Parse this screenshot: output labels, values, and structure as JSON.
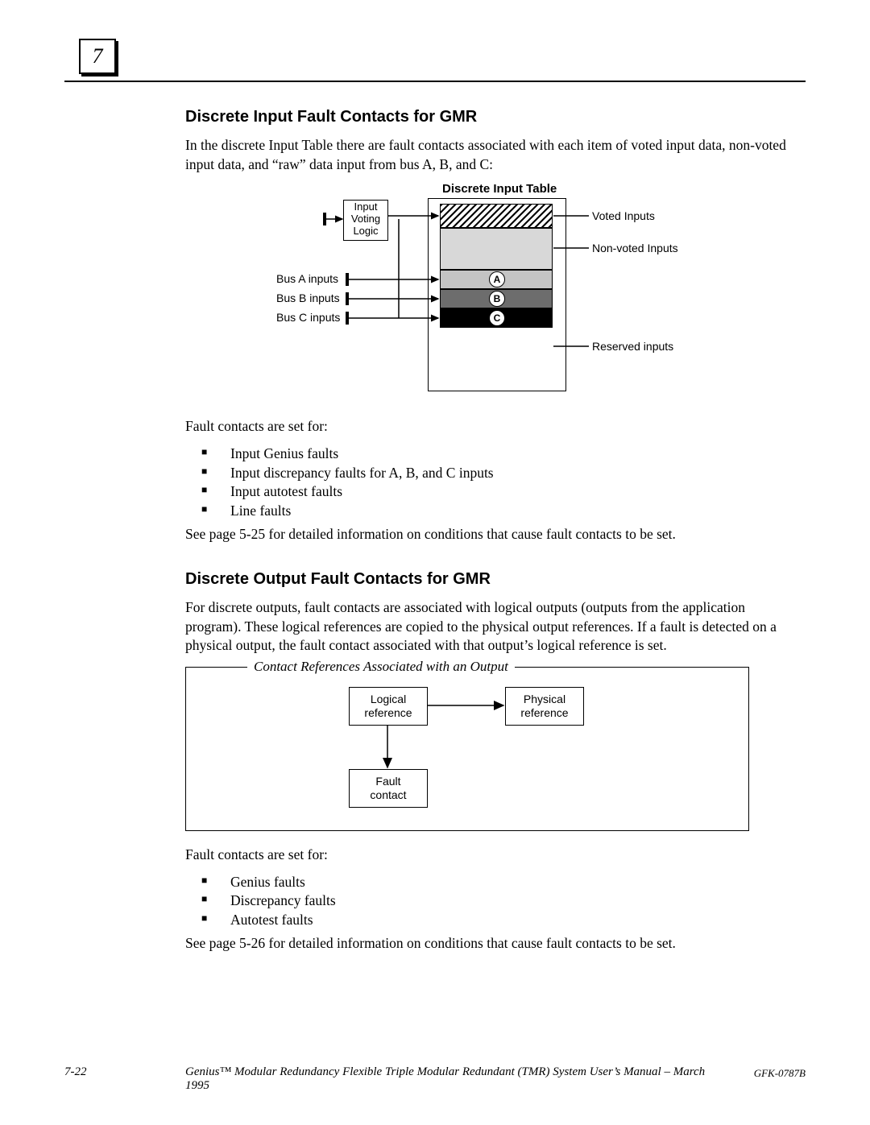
{
  "chapter_number": "7",
  "section1": {
    "title": "Discrete Input Fault Contacts for GMR",
    "intro": "In the discrete Input Table there are fault contacts associated with each item of voted input data, non-voted input data, and “raw” data input from bus A, B, and C:",
    "fig_title": "Discrete Input Table",
    "ivl_box": "Input\nVoting\nLogic",
    "labels": {
      "voted": "Voted Inputs",
      "nonvoted": "Non-voted Inputs",
      "reserved": "Reserved inputs",
      "busA": "Bus A inputs",
      "busB": "Bus B inputs",
      "busC": "Bus C inputs"
    },
    "badges": {
      "a": "A",
      "b": "B",
      "c": "C"
    },
    "fault_heading": "Fault contacts are set for:",
    "faults": [
      "Input Genius faults",
      "Input discrepancy faults for A, B, and C inputs",
      "Input autotest faults",
      "Line faults"
    ],
    "see": "See page 5-25 for detailed information on conditions that cause fault contacts to be set."
  },
  "section2": {
    "title": "Discrete Output Fault Contacts for GMR",
    "intro": "For discrete outputs, fault contacts are associated with logical outputs (outputs from the application program). These logical references are copied to the physical output references. If a fault is detected on a physical output, the fault contact associated with that output’s logical reference is set.",
    "fig_legend": "Contact References Associated with an Output",
    "boxes": {
      "logical": "Logical\nreference",
      "physical": "Physical\nreference",
      "fault": "Fault\ncontact"
    },
    "fault_heading": "Fault contacts are set for:",
    "faults": [
      "Genius faults",
      "Discrepancy faults",
      "Autotest faults"
    ],
    "see": "See page 5-26 for detailed information on conditions that cause fault contacts to be set."
  },
  "footer": {
    "page": "7-22",
    "title": "Genius™ Modular Redundancy Flexible Triple Modular Redundant (TMR) System User’s Manual – March 1995",
    "doc": "GFK-0787B"
  }
}
